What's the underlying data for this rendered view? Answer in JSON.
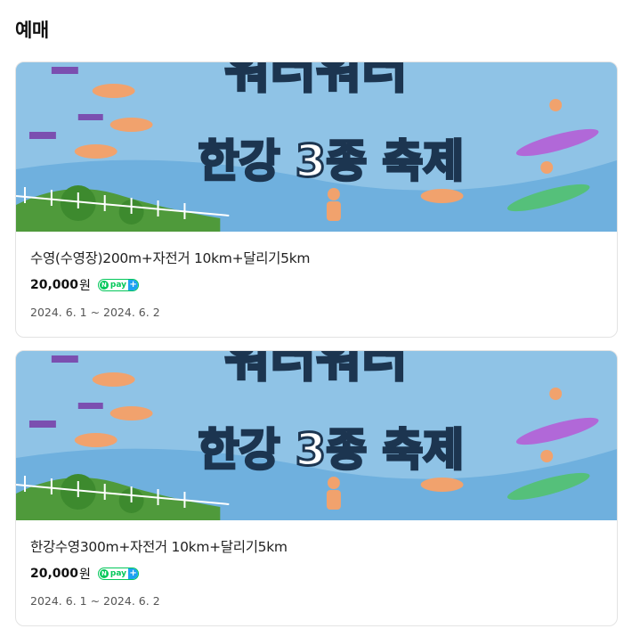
{
  "section": {
    "title": "예매"
  },
  "products": [
    {
      "banner_line1": "워터워터",
      "banner_line2": "한강 3종 축제",
      "title": "수영(수영장)200m+자전거 10km+달리기5km",
      "price": "20,000",
      "price_unit": "원",
      "date": "2024. 6. 1 ~ 2024. 6. 2"
    },
    {
      "banner_line1": "워터워터",
      "banner_line2": "한강 3종 축제",
      "title": "한강수영300m+자전거 10km+달리기5km",
      "price": "20,000",
      "price_unit": "원",
      "date": "2024. 6. 1 ~ 2024. 6. 2"
    }
  ],
  "badge": {
    "n": "N",
    "text": "pay",
    "plus": "+"
  },
  "colors": {
    "sky": "#8fc3e6",
    "river": "#6fb0de",
    "grass": "#4f9a3b",
    "npay_green": "#03c75a",
    "npay_blue": "#1ea1f2"
  }
}
